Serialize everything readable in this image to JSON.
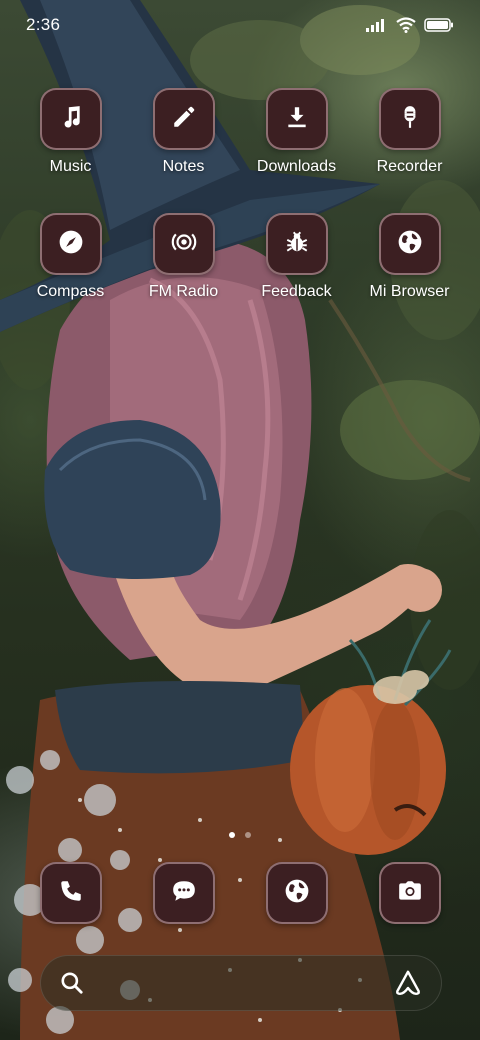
{
  "status_bar": {
    "time": "2:36",
    "icons": [
      "signal-icon",
      "wifi-icon",
      "battery-icon"
    ]
  },
  "apps": [
    {
      "label": "Music",
      "icon": "music-note-icon"
    },
    {
      "label": "Notes",
      "icon": "pencil-icon"
    },
    {
      "label": "Downloads",
      "icon": "download-icon"
    },
    {
      "label": "Recorder",
      "icon": "microphone-icon"
    },
    {
      "label": "Compass",
      "icon": "compass-icon"
    },
    {
      "label": "FM Radio",
      "icon": "radio-icon"
    },
    {
      "label": "Feedback",
      "icon": "bug-icon"
    },
    {
      "label": "Mi Browser",
      "icon": "globe-icon"
    }
  ],
  "page_indicator": {
    "pages": 2,
    "active": 1
  },
  "dock": [
    {
      "icon": "phone-icon"
    },
    {
      "icon": "message-icon"
    },
    {
      "icon": "globe-icon"
    },
    {
      "icon": "camera-icon"
    }
  ],
  "search_bar": {
    "left_icon": "search-icon",
    "right_icon": "assistant-icon"
  },
  "colors": {
    "icon_background": "#3c1f22",
    "icon_border": "#d2afb4",
    "text": "#ffffff"
  }
}
